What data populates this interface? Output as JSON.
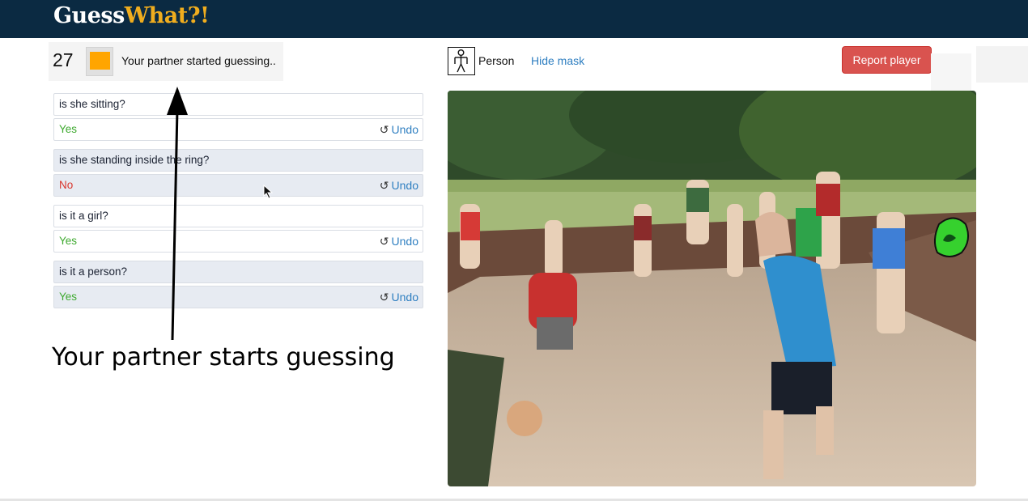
{
  "brand": {
    "part1": "Guess",
    "part2": "What?!"
  },
  "status": {
    "timer": "27",
    "message": "Your partner started guessing..",
    "player_color": "#ffa500"
  },
  "dialogue": [
    {
      "question": "is she sitting?",
      "answer": "Yes",
      "answer_type": "yes",
      "undo": "Undo"
    },
    {
      "question": "is she standing inside the ring?",
      "answer": "No",
      "answer_type": "no",
      "undo": "Undo"
    },
    {
      "question": "is it a girl?",
      "answer": "Yes",
      "answer_type": "yes",
      "undo": "Undo"
    },
    {
      "question": "is it a person?",
      "answer": "Yes",
      "answer_type": "yes",
      "undo": "Undo"
    }
  ],
  "annotation": {
    "text": "Your partner starts guessing"
  },
  "object": {
    "category": "Person",
    "category_icon": "person-icon"
  },
  "controls": {
    "hide_mask": "Hide mask",
    "report_player": "Report player"
  },
  "colors": {
    "header": "#0b2a42",
    "brand_accent": "#f0ad1e",
    "yes": "#3faa30",
    "no": "#d9342b",
    "link": "#2f7fc1",
    "report": "#d9534f",
    "mask": "#36d12e"
  }
}
